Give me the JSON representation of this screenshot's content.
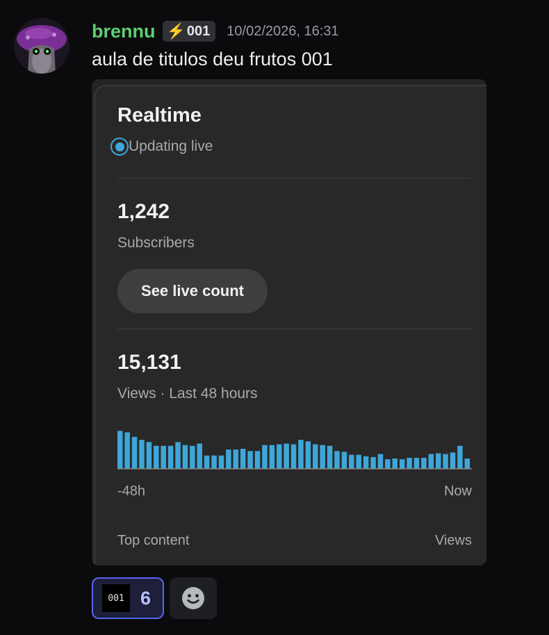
{
  "message": {
    "username": "brennu",
    "tag": "001",
    "timestamp": "10/02/2026, 16:31",
    "text": "aula de titulos deu frutos 001",
    "avatar_icon": "mushroom-avatar",
    "username_color": "#5dcf6f"
  },
  "card": {
    "title": "Realtime",
    "status": "Updating live",
    "subscribers_value": "1,242",
    "subscribers_label": "Subscribers",
    "live_count_button": "See live count",
    "views_value": "15,131",
    "views_label": "Views · Last 48 hours",
    "axis_start": "-48h",
    "axis_end": "Now",
    "top_content_label": "Top content",
    "top_content_metric": "Views",
    "accent_color": "#3ea6d8"
  },
  "chart_data": {
    "type": "bar",
    "values": [
      50,
      48,
      42,
      38,
      35,
      30,
      30,
      30,
      35,
      31,
      30,
      33,
      17,
      17,
      17,
      25,
      25,
      26,
      23,
      23,
      31,
      31,
      32,
      33,
      32,
      38,
      36,
      32,
      31,
      30,
      23,
      22,
      18,
      18,
      16,
      15,
      19,
      12,
      13,
      12,
      14,
      14,
      14,
      19,
      20,
      19,
      21,
      30,
      13
    ]
  },
  "reactions": [
    {
      "emoji": "001",
      "count": "6"
    }
  ],
  "add_reaction_icon": "smiley-icon"
}
